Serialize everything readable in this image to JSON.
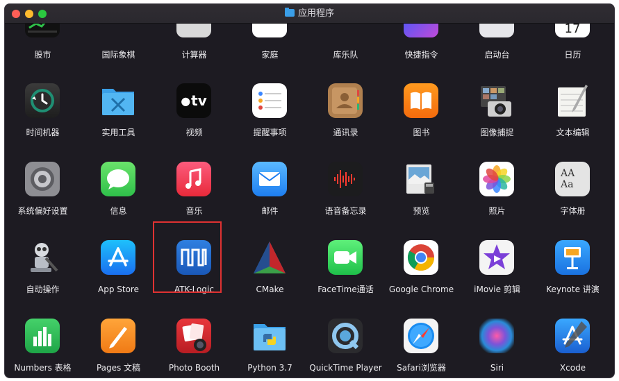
{
  "window": {
    "title": "应用程序"
  },
  "rows": [
    [
      "股市",
      "国际象棋",
      "计算器",
      "家庭",
      "库乐队",
      "快捷指令",
      "启动台",
      "日历"
    ],
    [
      "时间机器",
      "实用工具",
      "视频",
      "提醒事项",
      "通讯录",
      "图书",
      "图像捕捉",
      "文本编辑"
    ],
    [
      "系统偏好设置",
      "信息",
      "音乐",
      "邮件",
      "语音备忘录",
      "预览",
      "照片",
      "字体册"
    ],
    [
      "自动操作",
      "App Store",
      "ATK-Logic",
      "CMake",
      "FaceTime通话",
      "Google Chrome",
      "iMovie 剪辑",
      "Keynote 讲演"
    ],
    [
      "Numbers 表格",
      "Pages 文稿",
      "Photo Booth",
      "Python 3.7",
      "QuickTime Player",
      "Safari浏览器",
      "Siri",
      "Xcode"
    ]
  ],
  "icons": {
    "tv_text": "tv",
    "calendar_day": "17",
    "font_book_text": "AA Aa"
  },
  "selected_app": "ATK-Logic",
  "colors": {
    "window_bg": "#1d1b22",
    "selection": "#e03232"
  }
}
